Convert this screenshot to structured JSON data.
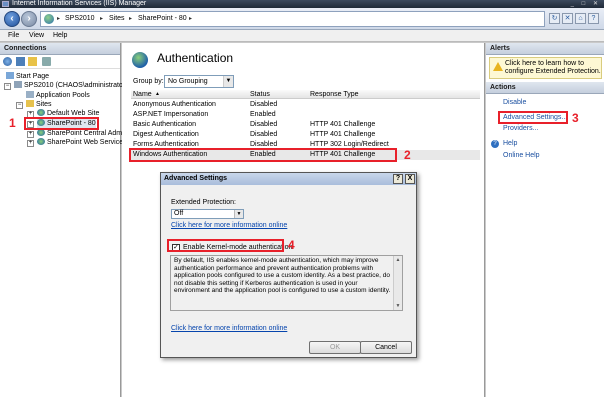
{
  "window": {
    "title": "Internet Information Services (IIS) Manager",
    "controls": "_ □ ✕"
  },
  "addressbar": {
    "crumbs": [
      "SPS2010",
      "Sites",
      "SharePoint - 80"
    ],
    "separator": "▸"
  },
  "menubar": {
    "items": [
      "File",
      "View",
      "Help"
    ]
  },
  "connections": {
    "title": "Connections",
    "tree": [
      {
        "label": "Start Page",
        "level": 1
      },
      {
        "label": "SPS2010 (CHAOS\\administrator)",
        "level": 1,
        "expander": "−"
      },
      {
        "label": "Application Pools",
        "level": 2
      },
      {
        "label": "Sites",
        "level": 2,
        "expander": "−"
      },
      {
        "label": "Default Web Site",
        "level": 3,
        "expander": "+"
      },
      {
        "label": "SharePoint - 80",
        "level": 3,
        "expander": "+"
      },
      {
        "label": "SharePoint Central Admi",
        "level": 3,
        "expander": "+"
      },
      {
        "label": "SharePoint Web Services",
        "level": 3,
        "expander": "+"
      }
    ]
  },
  "main": {
    "title": "Authentication",
    "group_by_label": "Group by:",
    "group_by_value": "No Grouping",
    "columns": [
      "Name",
      "Status",
      "Response Type"
    ],
    "sort_indicator": "▲",
    "rows": [
      {
        "name": "Anonymous Authentication",
        "status": "Disabled",
        "response": ""
      },
      {
        "name": "ASP.NET Impersonation",
        "status": "Enabled",
        "response": ""
      },
      {
        "name": "Basic Authentication",
        "status": "Disabled",
        "response": "HTTP 401 Challenge"
      },
      {
        "name": "Digest Authentication",
        "status": "Disabled",
        "response": "HTTP 401 Challenge"
      },
      {
        "name": "Forms Authentication",
        "status": "Disabled",
        "response": "HTTP 302 Login/Redirect"
      },
      {
        "name": "Windows Authentication",
        "status": "Enabled",
        "response": "HTTP 401 Challenge"
      }
    ]
  },
  "alerts": {
    "title": "Alerts",
    "message": "Click here to learn how to configure Extended Protection."
  },
  "actions": {
    "title": "Actions",
    "items": [
      "Disable",
      "Advanced Settings...",
      "Providers...",
      "Help",
      "Online Help"
    ]
  },
  "dialog": {
    "title": "Advanced Settings",
    "help_btn": "?",
    "close_btn": "X",
    "ext_label": "Extended Protection:",
    "ext_value": "Off",
    "link1": "Click here for more information online",
    "kernel_label": "Enable Kernel-mode authentication",
    "kernel_checked": "✓",
    "description": "By default, IIS enables kernel-mode authentication, which may improve authentication performance and prevent authentication problems with application pools configured to use a custom identity. As a best practice, do not disable this setting if Kerberos authentication is used in your environment and the application pool is configured to use a custom identity.",
    "link2": "Click here for more information online",
    "ok": "OK",
    "cancel": "Cancel"
  },
  "callouts": [
    "1",
    "2",
    "3",
    "4"
  ],
  "colors": {
    "callout": "#e8202a",
    "link": "#1a4fa0",
    "highlight": "#e8e8e8"
  }
}
